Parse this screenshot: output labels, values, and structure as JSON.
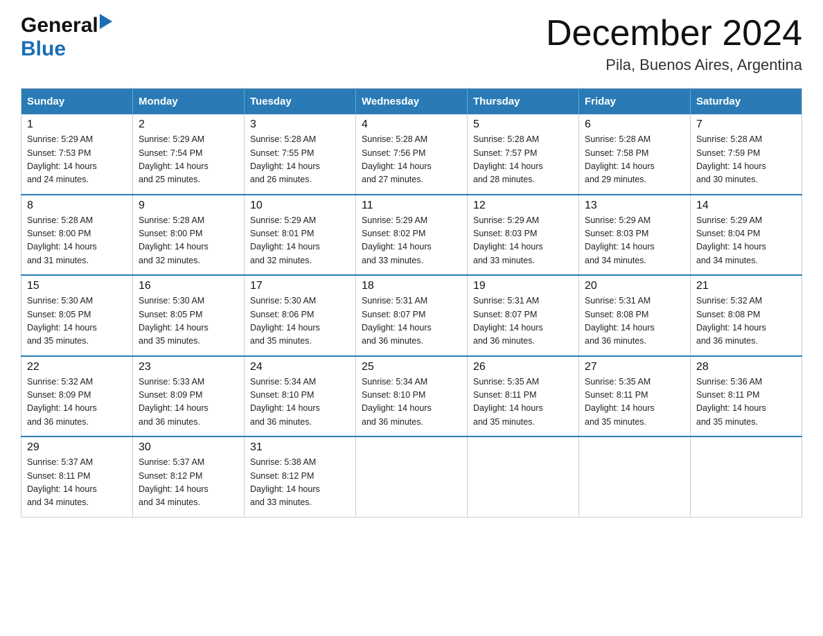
{
  "header": {
    "title": "December 2024",
    "subtitle": "Pila, Buenos Aires, Argentina",
    "logo_general": "General",
    "logo_blue": "Blue"
  },
  "weekdays": [
    "Sunday",
    "Monday",
    "Tuesday",
    "Wednesday",
    "Thursday",
    "Friday",
    "Saturday"
  ],
  "weeks": [
    [
      {
        "day": "1",
        "sunrise": "5:29 AM",
        "sunset": "7:53 PM",
        "daylight": "14 hours and 24 minutes."
      },
      {
        "day": "2",
        "sunrise": "5:29 AM",
        "sunset": "7:54 PM",
        "daylight": "14 hours and 25 minutes."
      },
      {
        "day": "3",
        "sunrise": "5:28 AM",
        "sunset": "7:55 PM",
        "daylight": "14 hours and 26 minutes."
      },
      {
        "day": "4",
        "sunrise": "5:28 AM",
        "sunset": "7:56 PM",
        "daylight": "14 hours and 27 minutes."
      },
      {
        "day": "5",
        "sunrise": "5:28 AM",
        "sunset": "7:57 PM",
        "daylight": "14 hours and 28 minutes."
      },
      {
        "day": "6",
        "sunrise": "5:28 AM",
        "sunset": "7:58 PM",
        "daylight": "14 hours and 29 minutes."
      },
      {
        "day": "7",
        "sunrise": "5:28 AM",
        "sunset": "7:59 PM",
        "daylight": "14 hours and 30 minutes."
      }
    ],
    [
      {
        "day": "8",
        "sunrise": "5:28 AM",
        "sunset": "8:00 PM",
        "daylight": "14 hours and 31 minutes."
      },
      {
        "day": "9",
        "sunrise": "5:28 AM",
        "sunset": "8:00 PM",
        "daylight": "14 hours and 32 minutes."
      },
      {
        "day": "10",
        "sunrise": "5:29 AM",
        "sunset": "8:01 PM",
        "daylight": "14 hours and 32 minutes."
      },
      {
        "day": "11",
        "sunrise": "5:29 AM",
        "sunset": "8:02 PM",
        "daylight": "14 hours and 33 minutes."
      },
      {
        "day": "12",
        "sunrise": "5:29 AM",
        "sunset": "8:03 PM",
        "daylight": "14 hours and 33 minutes."
      },
      {
        "day": "13",
        "sunrise": "5:29 AM",
        "sunset": "8:03 PM",
        "daylight": "14 hours and 34 minutes."
      },
      {
        "day": "14",
        "sunrise": "5:29 AM",
        "sunset": "8:04 PM",
        "daylight": "14 hours and 34 minutes."
      }
    ],
    [
      {
        "day": "15",
        "sunrise": "5:30 AM",
        "sunset": "8:05 PM",
        "daylight": "14 hours and 35 minutes."
      },
      {
        "day": "16",
        "sunrise": "5:30 AM",
        "sunset": "8:05 PM",
        "daylight": "14 hours and 35 minutes."
      },
      {
        "day": "17",
        "sunrise": "5:30 AM",
        "sunset": "8:06 PM",
        "daylight": "14 hours and 35 minutes."
      },
      {
        "day": "18",
        "sunrise": "5:31 AM",
        "sunset": "8:07 PM",
        "daylight": "14 hours and 36 minutes."
      },
      {
        "day": "19",
        "sunrise": "5:31 AM",
        "sunset": "8:07 PM",
        "daylight": "14 hours and 36 minutes."
      },
      {
        "day": "20",
        "sunrise": "5:31 AM",
        "sunset": "8:08 PM",
        "daylight": "14 hours and 36 minutes."
      },
      {
        "day": "21",
        "sunrise": "5:32 AM",
        "sunset": "8:08 PM",
        "daylight": "14 hours and 36 minutes."
      }
    ],
    [
      {
        "day": "22",
        "sunrise": "5:32 AM",
        "sunset": "8:09 PM",
        "daylight": "14 hours and 36 minutes."
      },
      {
        "day": "23",
        "sunrise": "5:33 AM",
        "sunset": "8:09 PM",
        "daylight": "14 hours and 36 minutes."
      },
      {
        "day": "24",
        "sunrise": "5:34 AM",
        "sunset": "8:10 PM",
        "daylight": "14 hours and 36 minutes."
      },
      {
        "day": "25",
        "sunrise": "5:34 AM",
        "sunset": "8:10 PM",
        "daylight": "14 hours and 36 minutes."
      },
      {
        "day": "26",
        "sunrise": "5:35 AM",
        "sunset": "8:11 PM",
        "daylight": "14 hours and 35 minutes."
      },
      {
        "day": "27",
        "sunrise": "5:35 AM",
        "sunset": "8:11 PM",
        "daylight": "14 hours and 35 minutes."
      },
      {
        "day": "28",
        "sunrise": "5:36 AM",
        "sunset": "8:11 PM",
        "daylight": "14 hours and 35 minutes."
      }
    ],
    [
      {
        "day": "29",
        "sunrise": "5:37 AM",
        "sunset": "8:11 PM",
        "daylight": "14 hours and 34 minutes."
      },
      {
        "day": "30",
        "sunrise": "5:37 AM",
        "sunset": "8:12 PM",
        "daylight": "14 hours and 34 minutes."
      },
      {
        "day": "31",
        "sunrise": "5:38 AM",
        "sunset": "8:12 PM",
        "daylight": "14 hours and 33 minutes."
      },
      null,
      null,
      null,
      null
    ]
  ],
  "labels": {
    "sunrise": "Sunrise:",
    "sunset": "Sunset:",
    "daylight": "Daylight:"
  }
}
